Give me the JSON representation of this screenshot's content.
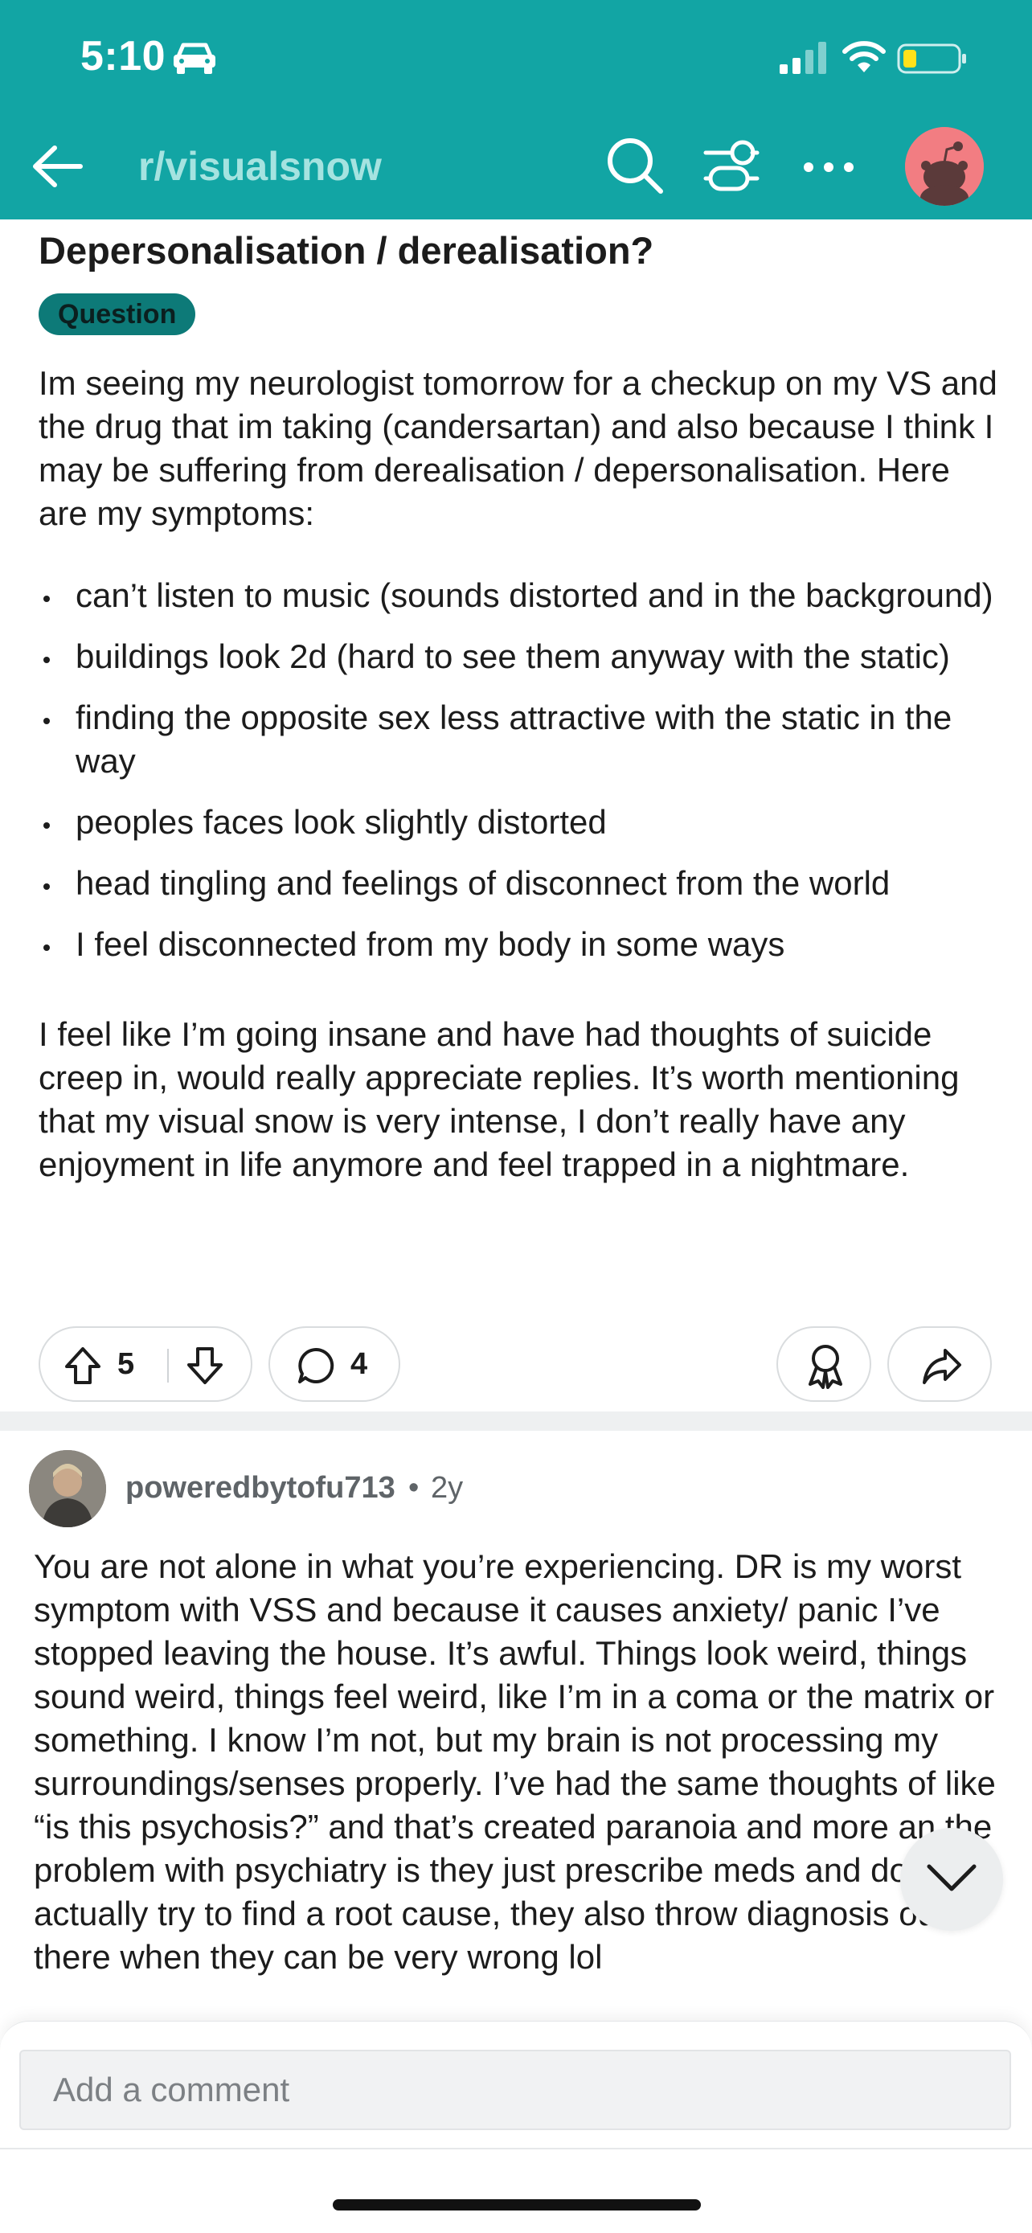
{
  "status_bar": {
    "time": "5:10",
    "icons": [
      "car-icon",
      "signal-icon",
      "wifi-icon",
      "battery-icon"
    ]
  },
  "header": {
    "subreddit": "r/visualsnow",
    "icons": [
      "back-arrow-icon",
      "search-icon",
      "filter-icon",
      "more-icon",
      "avatar"
    ]
  },
  "post": {
    "title": "Depersonalisation / derealisation?",
    "flair": "Question",
    "intro": "Im seeing my neurologist tomorrow for a checkup on my VS and the drug that im taking (candersartan) and also because I think I may be suffering from derealisation / depersonalisation. Here are my symptoms:",
    "symptoms": [
      "can’t listen to music (sounds distorted and in the background)",
      "buildings look 2d (hard to see them anyway with the static)",
      "finding the opposite sex less attractive with the static in the way",
      "peoples faces look slightly distorted",
      "head tingling and feelings of disconnect from the world",
      "I feel disconnected from my body in some ways"
    ],
    "closing": "I feel like I’m going insane and have had thoughts of suicide creep in, would really appreciate replies. It’s worth mentioning that my visual snow is very intense, I don’t really have any enjoyment in life anymore and feel trapped in a nightmare.",
    "votes": "5",
    "comments": "4"
  },
  "comment": {
    "author": "poweredbytofu713",
    "separator": "•",
    "age": "2y",
    "body": "You are not alone in what you’re experiencing. DR is my worst symptom with VSS and because it causes anxiety/ panic I’ve stopped leaving the house. It’s awful. Things look weird, things sound weird, things feel weird, like I’m in a coma or the matrix or something. I know I’m not, but my brain is not processing my surroundings/senses properly. I’ve had the same thoughts of like “is this psychosis?” and that’s created paranoia and more an the problem with psychiatry is they just prescribe meds and don’t actually try to find a root cause, they also throw diagnosis out there when they can be very wrong lol"
  },
  "composer": {
    "placeholder": "Add a comment"
  },
  "colors": {
    "header_bg": "#12a5a4",
    "subreddit_text": "#a5e3e0",
    "flair_bg": "#0d7a78",
    "avatar_bg": "#f27d82"
  }
}
